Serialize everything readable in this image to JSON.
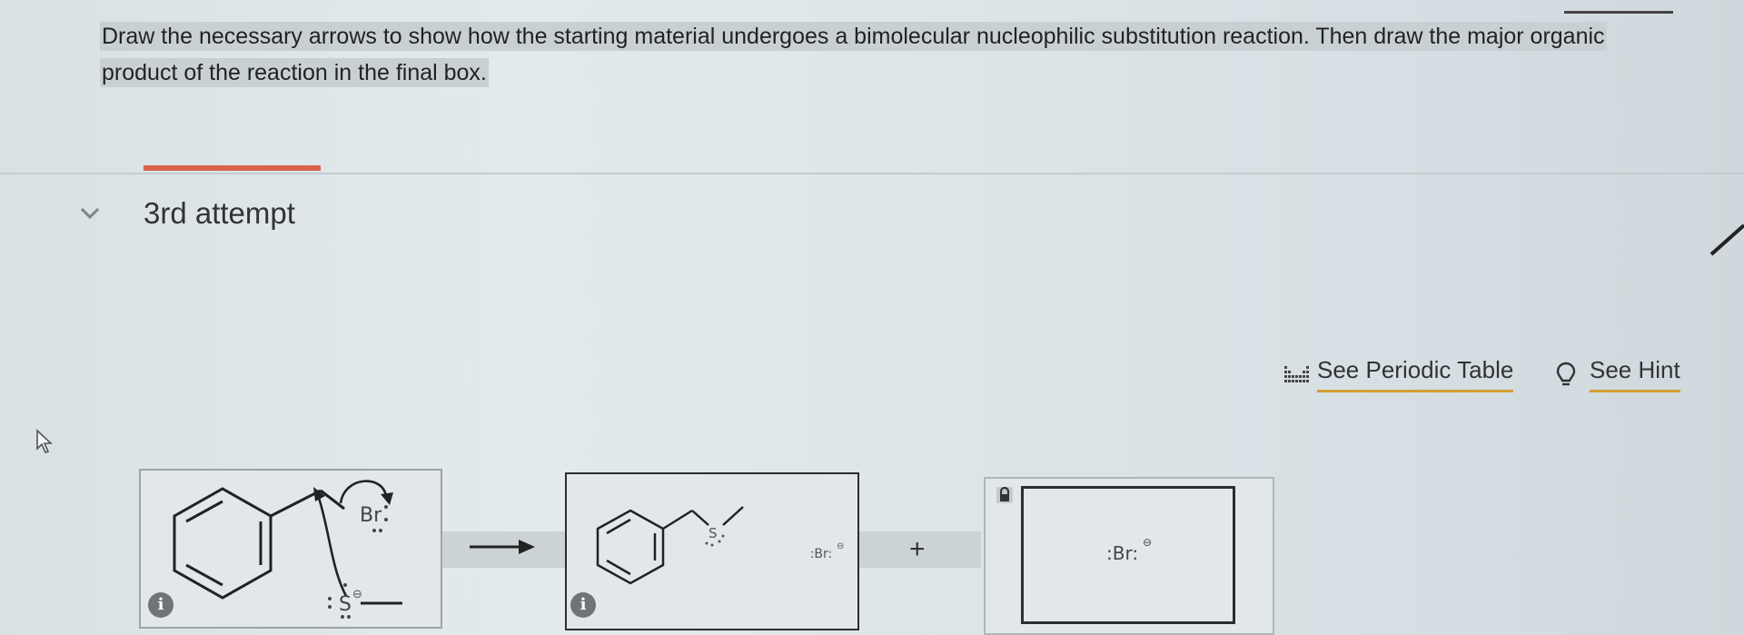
{
  "question": {
    "text": "Draw the necessary arrows to show how the starting material undergoes a bimolecular nucleophilic substitution reaction. Then draw the major organic product of the reaction in the final box."
  },
  "attempt": {
    "label": "3rd attempt"
  },
  "tools": {
    "periodic_table": "See Periodic Table",
    "hint": "See Hint"
  },
  "reaction": {
    "reactant": {
      "leaving_group": "Br",
      "nucleophile_atom": "S"
    },
    "arrow_glyph": "→",
    "product": {
      "sulfur_label": "S",
      "byproduct": ":Br:"
    },
    "plus_sign": "+",
    "final_box": {
      "content": ":Br:"
    }
  },
  "colors": {
    "accent_attempt": "#d9614a",
    "tool_underline": "#d39e34"
  },
  "icons": {
    "chevron": "chevron-down-icon",
    "periodic": "periodic-table-icon",
    "hint": "lightbulb-icon",
    "info": "info-icon",
    "lock": "lock-icon",
    "cursor": "mouse-cursor-icon"
  }
}
